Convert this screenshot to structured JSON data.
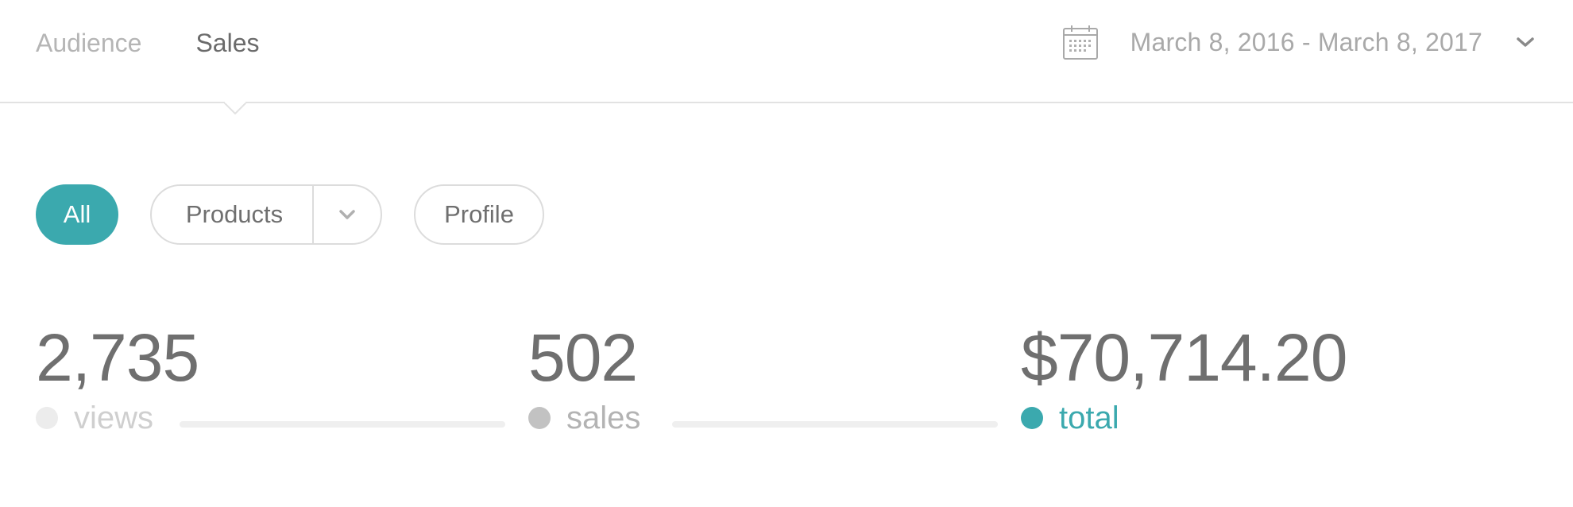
{
  "nav": {
    "tabs": [
      {
        "label": "Audience",
        "active": false
      },
      {
        "label": "Sales",
        "active": true
      }
    ]
  },
  "date_range": {
    "label": "March 8, 2016 - March 8, 2017",
    "icon": "calendar-icon",
    "dropdown_icon": "chevron-down-icon"
  },
  "filters": {
    "all_label": "All",
    "products_label": "Products",
    "products_dropdown_icon": "chevron-down-icon",
    "profile_label": "Profile"
  },
  "stats": {
    "views": {
      "value": "2,735",
      "label": "views",
      "dot_color": "#ececec",
      "label_color": "#cfcfcf"
    },
    "sales": {
      "value": "502",
      "label": "sales",
      "dot_color": "#c2c2c2",
      "label_color": "#b3b3b3"
    },
    "total": {
      "value": "$70,714.20",
      "label": "total",
      "dot_color": "#3ba9ae",
      "label_color": "#3ba9ae"
    }
  },
  "colors": {
    "accent": "#3ba9ae",
    "divider": "#e2e2e2",
    "text": "#6f6f6f",
    "muted": "#b5b5b5"
  }
}
